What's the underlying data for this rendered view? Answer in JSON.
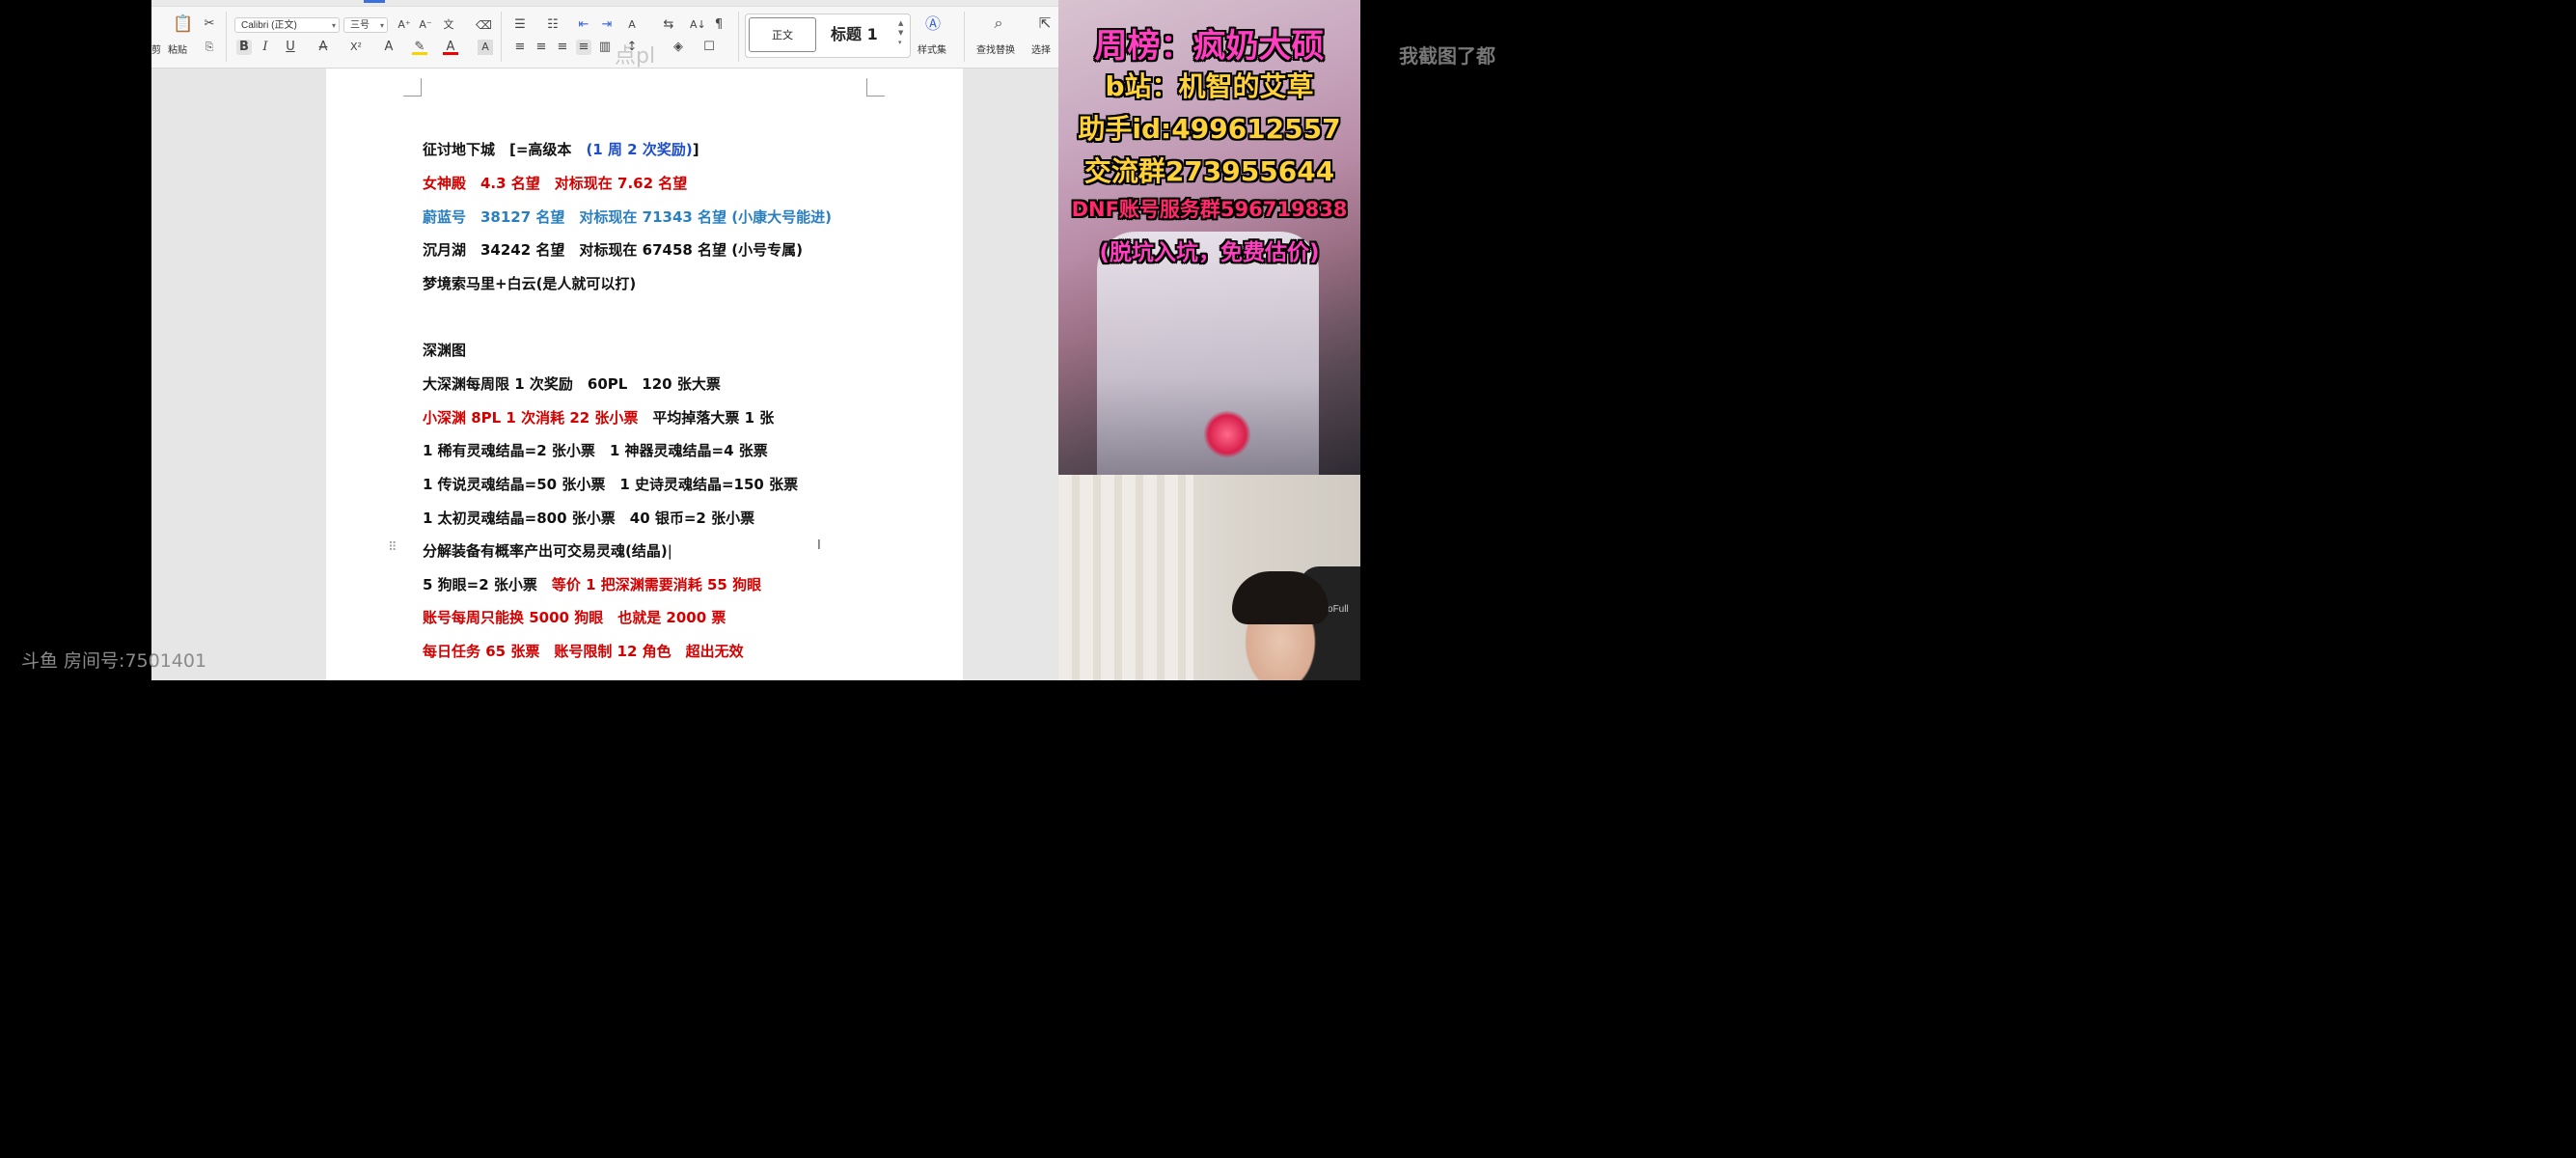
{
  "toolbar": {
    "paste_label": "粘贴",
    "cut_label": "剪",
    "font_name": "Calibri (正文)",
    "font_size": "三号",
    "style_normal": "正文",
    "style_heading": "标题 1",
    "style_set_label": "样式集",
    "find_replace_label": "查找替换",
    "select_label": "选择"
  },
  "watermark_ghost": "点pl",
  "document": {
    "lines": [
      {
        "segments": [
          {
            "text": "征讨地下城　[=高级本　",
            "color": "blk"
          },
          {
            "text": "(1 周 2 次奖励)",
            "color": "blue"
          },
          {
            "text": "]",
            "color": "blk"
          }
        ]
      },
      {
        "segments": [
          {
            "text": "女神殿　4.3 名望　对标现在 7.62 名望",
            "color": "red"
          }
        ]
      },
      {
        "segments": [
          {
            "text": "蔚蓝号　38127 名望　对标现在 71343 名望 (小康大号能进)",
            "color": "teal"
          }
        ]
      },
      {
        "segments": [
          {
            "text": "沉月湖　34242 名望　对标现在 67458 名望 (小号专属)",
            "color": "blk"
          }
        ]
      },
      {
        "segments": [
          {
            "text": "梦境索马里+白云(是人就可以打)",
            "color": "blk"
          }
        ]
      },
      {
        "segments": [
          {
            "text": "深渊图",
            "color": "blk"
          }
        ]
      },
      {
        "segments": [
          {
            "text": "大深渊每周限 1 次奖励　60PL　120 张大票",
            "color": "blk"
          }
        ]
      },
      {
        "segments": [
          {
            "text": "小深渊 8PL 1 次消耗 22 张小票　",
            "color": "red"
          },
          {
            "text": "平均掉落大票 1 张",
            "color": "blk"
          }
        ]
      },
      {
        "segments": [
          {
            "text": "1 稀有灵魂结晶=2 张小票　1 神器灵魂结晶=4 张票",
            "color": "blk"
          }
        ]
      },
      {
        "segments": [
          {
            "text": "1 传说灵魂结晶=50 张小票　1 史诗灵魂结晶=150 张票",
            "color": "blk"
          }
        ]
      },
      {
        "segments": [
          {
            "text": "1 太初灵魂结晶=800 张小票　40 银币=2 张小票",
            "color": "blk"
          }
        ]
      },
      {
        "segments": [
          {
            "text": "分解装备有概率产出可交易灵魂(结晶)",
            "color": "blk"
          }
        ]
      },
      {
        "segments": [
          {
            "text": "5 狗眼=2 张小票　",
            "color": "blk"
          },
          {
            "text": "等价 1 把深渊需要消耗 55 狗眼",
            "color": "red"
          }
        ]
      },
      {
        "segments": [
          {
            "text": "账号每周只能换 5000 狗眼　也就是 2000 票",
            "color": "red"
          }
        ]
      },
      {
        "segments": [
          {
            "text": "每日任务 65 张票　账号限制 12 角色　超出无效",
            "color": "red"
          }
        ]
      }
    ]
  },
  "stream_overlay": {
    "line1": "周榜：疯奶大硕",
    "line2": "b站：机智的艾草",
    "line3": "助手id:499612557",
    "line4": "交流群273955644",
    "line5": "DNF账号服务群596719838",
    "line6": "(脱坑入坑，免费估价)"
  },
  "webcam_chair_text": "AutoFull",
  "right_text": "我截图了都",
  "room_label": "斗鱼 房间号:7501401"
}
